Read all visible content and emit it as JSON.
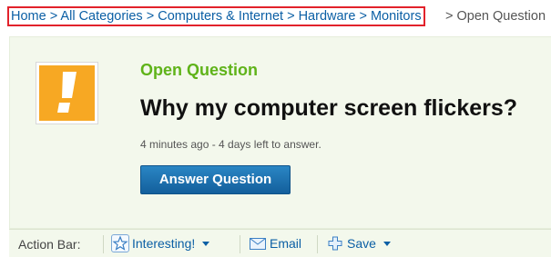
{
  "breadcrumb": {
    "items": [
      "Home",
      "All Categories",
      "Computers & Internet",
      "Hardware",
      "Monitors"
    ],
    "separator": " > ",
    "current": "Open Question"
  },
  "question": {
    "status": "Open Question",
    "title": "Why my computer screen flickers?",
    "meta": "4 minutes ago - 4 days left to answer.",
    "answer_button": "Answer Question"
  },
  "action_bar": {
    "label": "Action Bar:",
    "interesting": "Interesting!",
    "email": "Email",
    "save": "Save"
  },
  "colors": {
    "link": "#0b5fa5",
    "status_green": "#5fb319",
    "panel_bg": "#f3f8ec",
    "icon_orange": "#f7a823",
    "button_blue": "#1a6fae",
    "highlight_red": "#e2222b"
  },
  "icons": {
    "question": "exclamation-icon",
    "interesting": "star-icon",
    "email": "envelope-icon",
    "save": "plus-icon"
  }
}
